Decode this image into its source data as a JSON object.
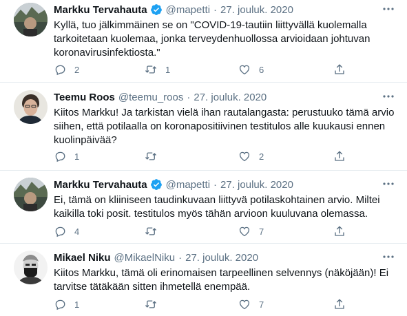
{
  "tweets": [
    {
      "name": "Markku Tervahauta",
      "verified": true,
      "handle": "@mapetti",
      "separator": "·",
      "date": "27. jouluk. 2020",
      "lines": [
        "Kyllä, tuo jälkimmäinen se on \"COVID-19-tautiin liittyvällä kuolemalla",
        "tarkoitetaan kuolemaa, jonka terveydenhuollossa arvioidaan johtuvan",
        "koronavirusinfektiosta.\""
      ],
      "replies": "2",
      "retweets": "1",
      "likes": "6"
    },
    {
      "name": "Teemu Roos",
      "verified": false,
      "handle": "@teemu_roos",
      "separator": "·",
      "date": "27. jouluk. 2020",
      "lines": [
        "Kiitos Markku! Ja tarkistan vielä ihan rautalangasta: perustuuko tämä arvio",
        "siihen, että potilaalla on koronapositiivinen testitulos alle kuukausi ennen",
        "kuolinpäivää?"
      ],
      "replies": "1",
      "retweets": "",
      "likes": "2"
    },
    {
      "name": "Markku Tervahauta",
      "verified": true,
      "handle": "@mapetti",
      "separator": "·",
      "date": "27. jouluk. 2020",
      "lines": [
        "Ei, tämä on kliiniseen taudinkuvaan liittyvä potilaskohtainen arvio. Miltei",
        "kaikilla toki posit. testitulos myös tähän arvioon kuuluvana olemassa."
      ],
      "replies": "4",
      "retweets": "",
      "likes": "7"
    },
    {
      "name": "Mikael Niku",
      "verified": false,
      "handle": "@MikaelNiku",
      "separator": "·",
      "date": "27. jouluk. 2020",
      "lines": [
        "Kiitos Markku, tämä oli erinomaisen tarpeellinen selvennys (näköjään)! Ei",
        "tarvitse tätäkään sitten ihmetellä enempää."
      ],
      "replies": "1",
      "retweets": "",
      "likes": "7"
    }
  ],
  "icons": {
    "reply": "reply-icon",
    "retweet": "retweet-icon",
    "like": "heart-icon",
    "share": "share-icon",
    "more": "more-icon",
    "verified": "verified-badge-icon"
  },
  "colors": {
    "text": "#0f1419",
    "secondary": "#5b7083",
    "verified": "#1da1f2",
    "divider": "#e6ecf0"
  }
}
